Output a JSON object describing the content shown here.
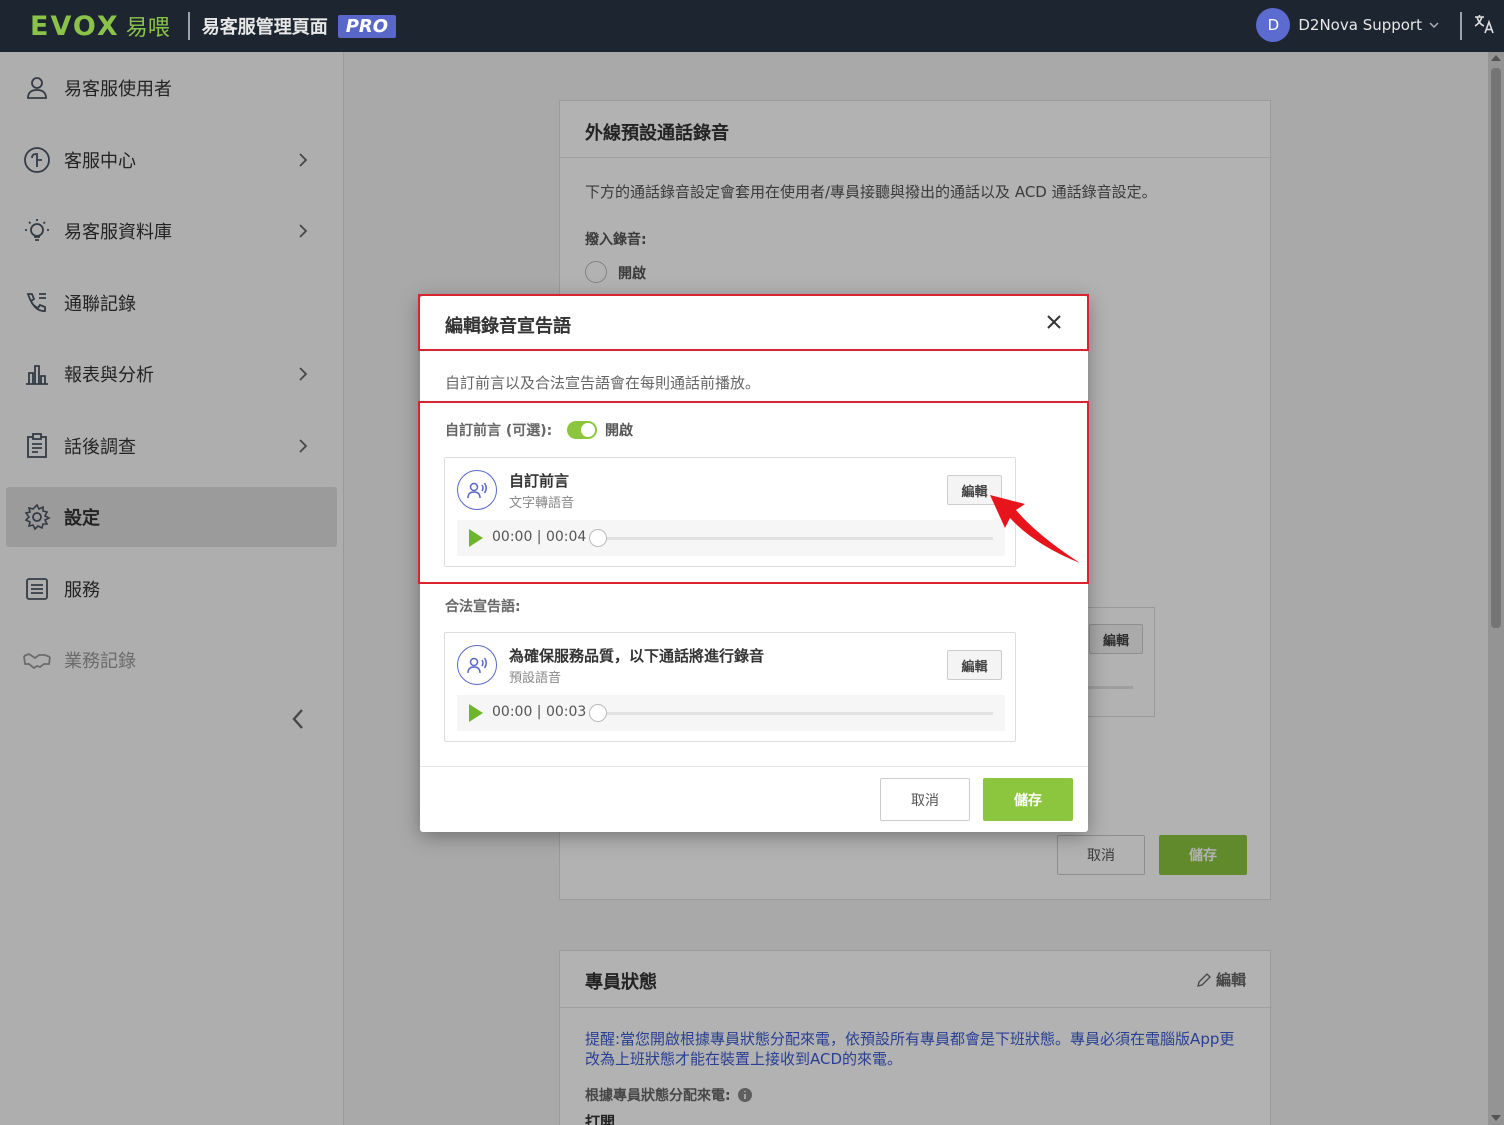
{
  "topbar": {
    "logo_text": "EVOX",
    "logo_cn": "易喂",
    "title": "易客服管理頁面",
    "badge": "PRO",
    "user_initial": "D",
    "user_name": "D2Nova Support"
  },
  "sidebar": {
    "items": [
      {
        "label": "易客服使用者",
        "icon": "user-icon"
      },
      {
        "label": "客服中心",
        "icon": "headset-icon"
      },
      {
        "label": "易客服資料庫",
        "icon": "lightbulb-icon"
      },
      {
        "label": "通聯記錄",
        "icon": "phone-log-icon"
      },
      {
        "label": "報表與分析",
        "icon": "bar-chart-icon"
      },
      {
        "label": "話後調查",
        "icon": "clipboard-icon"
      },
      {
        "label": "設定",
        "icon": "gear-icon"
      },
      {
        "label": "服務",
        "icon": "list-icon"
      },
      {
        "label": "業務記錄",
        "icon": "handshake-icon"
      }
    ]
  },
  "main": {
    "recording_card": {
      "title": "外線預設通話錄音",
      "desc": "下方的通話錄音設定會套用在使用者/專員接聽與撥出的通話以及 ACD 通話錄音設定。",
      "inbound_label": "撥入錄音:",
      "inbound_option": "開啟",
      "edit_label": "編輯",
      "cancel_label": "取消",
      "save_label": "儲存"
    },
    "agent_card": {
      "title": "專員狀態",
      "edit_label": "編輯",
      "notice": "提醒:當您開啟根據專員狀態分配來電，依預設所有專員都會是下班狀態。專員必須在電腦版App更改為上班狀態才能在裝置上接收到ACD的來電。",
      "assign_label": "根據專員狀態分配來電:",
      "assign_value": "打開"
    }
  },
  "modal": {
    "title": "編輯錄音宣告語",
    "desc": "自訂前言以及合法宣告語會在每則通話前播放。",
    "custom_label": "自訂前言 (可選):",
    "custom_toggle_label": "開啟",
    "custom_audio": {
      "title": "自訂前言",
      "subtitle": "文字轉語音",
      "edit_label": "編輯",
      "time": "00:00 | 00:04",
      "progress": 0
    },
    "legal_label": "合法宣告語:",
    "legal_audio": {
      "title": "為確保服務品質，以下通話將進行錄音",
      "subtitle": "預設語音",
      "edit_label": "編輯",
      "time": "00:00 | 00:03",
      "progress": 0
    },
    "cancel_label": "取消",
    "save_label": "儲存"
  },
  "colors": {
    "accent_green": "#8cc63f",
    "brand_purple": "#5967c9",
    "highlight_red": "#d9232e",
    "topbar_bg": "#1c2530"
  }
}
